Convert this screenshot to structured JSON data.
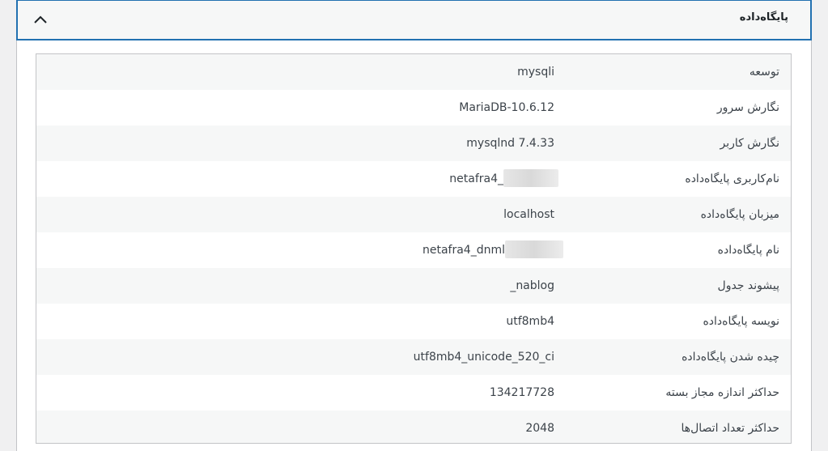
{
  "header": {
    "title": "پایگاه‌داده",
    "toggle_icon": "chevron-up-icon"
  },
  "rows": [
    {
      "label": "توسعه",
      "value": "mysqli"
    },
    {
      "label": "نگارش سرور",
      "value": "MariaDB-10.6.12"
    },
    {
      "label": "نگارش کاربر",
      "value": "mysqlnd 7.4.33"
    },
    {
      "label": "نام‌کاربری پایگاه‌داده",
      "value": "netafra4_",
      "redacted": true
    },
    {
      "label": "میزبان پایگاه‌داده",
      "value": "localhost"
    },
    {
      "label": "نام پایگاه‌داده",
      "value": "netafra4_dnml",
      "redacted": true
    },
    {
      "label": "پیشوند جدول",
      "value": "_nablog"
    },
    {
      "label": "نویسه پایگاه‌داده",
      "value": "utf8mb4"
    },
    {
      "label": "چیده شدن پایگاه‌داده",
      "value": "utf8mb4_unicode_520_ci"
    },
    {
      "label": "حداکثر اندازه مجاز بسته",
      "value": "134217728"
    },
    {
      "label": "حداکثر تعداد اتصال‌ها",
      "value": "2048"
    }
  ]
}
